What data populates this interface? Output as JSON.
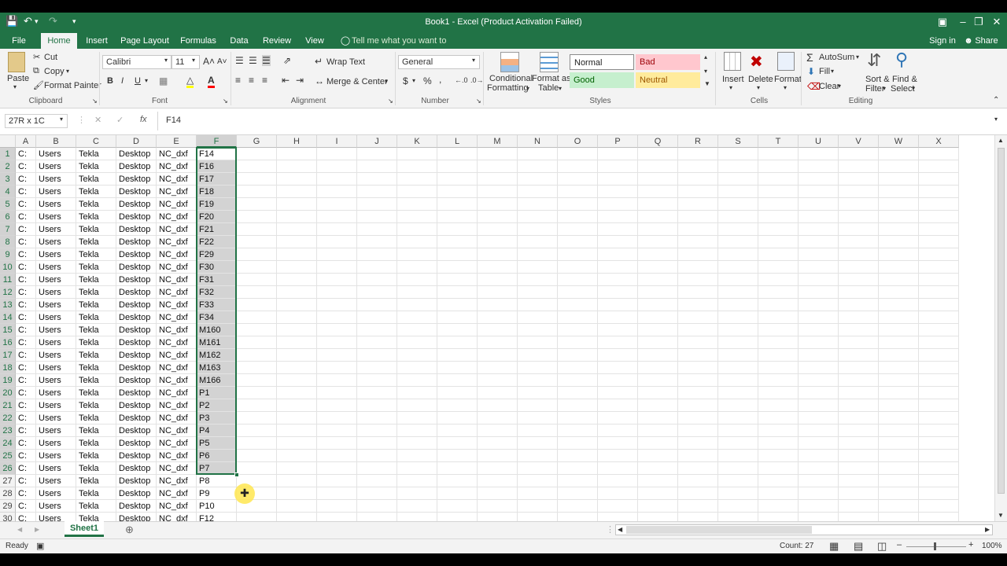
{
  "title": "Book1 - Excel (Product Activation Failed)",
  "tabs": [
    "File",
    "Home",
    "Insert",
    "Page Layout",
    "Formulas",
    "Data",
    "Review",
    "View"
  ],
  "tell_me": "Tell me what you want to do...",
  "sign_in": "Sign in",
  "share": "Share",
  "clipboard": {
    "paste": "Paste",
    "cut": "Cut",
    "copy": "Copy",
    "format_painter": "Format Painter",
    "label": "Clipboard"
  },
  "font": {
    "name": "Calibri",
    "size": "11",
    "bold": "B",
    "italic": "I",
    "underline": "U",
    "label": "Font"
  },
  "alignment": {
    "wrap_text": "Wrap Text",
    "merge_center": "Merge & Center",
    "label": "Alignment"
  },
  "number": {
    "format": "General",
    "currency": "$",
    "percent": "%",
    "comma": ",",
    "label": "Number"
  },
  "styles": {
    "conditional_formatting_1": "Conditional",
    "conditional_formatting_2": "Formatting",
    "format_as_table_1": "Format as",
    "format_as_table_2": "Table",
    "normal": "Normal",
    "bad": "Bad",
    "good": "Good",
    "neutral": "Neutral",
    "label": "Styles",
    "colors": {
      "normal": "#ffffff",
      "bad": "#ffc7ce",
      "good": "#c6efce",
      "neutral": "#ffeb9c"
    }
  },
  "cells_group": {
    "insert": "Insert",
    "delete": "Delete",
    "format": "Format",
    "label": "Cells"
  },
  "editing": {
    "autosum": "AutoSum",
    "fill": "Fill",
    "clear": "Clear",
    "sort_filter_1": "Sort &",
    "sort_filter_2": "Filter",
    "find_select_1": "Find &",
    "find_select_2": "Select",
    "label": "Editing"
  },
  "name_box": "27R x 1C",
  "fx": "fx",
  "formula": "F14",
  "columns": [
    "A",
    "B",
    "C",
    "D",
    "E",
    "F",
    "G",
    "H",
    "I",
    "J",
    "K",
    "L",
    "M",
    "N",
    "O",
    "P",
    "Q",
    "R",
    "S",
    "T",
    "U",
    "V",
    "W",
    "X"
  ],
  "rows": [
    [
      "1",
      "C:",
      "Users",
      "Tekla",
      "Desktop",
      "NC_dxf",
      "F14"
    ],
    [
      "2",
      "C:",
      "Users",
      "Tekla",
      "Desktop",
      "NC_dxf",
      "F16"
    ],
    [
      "3",
      "C:",
      "Users",
      "Tekla",
      "Desktop",
      "NC_dxf",
      "F17"
    ],
    [
      "4",
      "C:",
      "Users",
      "Tekla",
      "Desktop",
      "NC_dxf",
      "F18"
    ],
    [
      "5",
      "C:",
      "Users",
      "Tekla",
      "Desktop",
      "NC_dxf",
      "F19"
    ],
    [
      "6",
      "C:",
      "Users",
      "Tekla",
      "Desktop",
      "NC_dxf",
      "F20"
    ],
    [
      "7",
      "C:",
      "Users",
      "Tekla",
      "Desktop",
      "NC_dxf",
      "F21"
    ],
    [
      "8",
      "C:",
      "Users",
      "Tekla",
      "Desktop",
      "NC_dxf",
      "F22"
    ],
    [
      "9",
      "C:",
      "Users",
      "Tekla",
      "Desktop",
      "NC_dxf",
      "F29"
    ],
    [
      "10",
      "C:",
      "Users",
      "Tekla",
      "Desktop",
      "NC_dxf",
      "F30"
    ],
    [
      "11",
      "C:",
      "Users",
      "Tekla",
      "Desktop",
      "NC_dxf",
      "F31"
    ],
    [
      "12",
      "C:",
      "Users",
      "Tekla",
      "Desktop",
      "NC_dxf",
      "F32"
    ],
    [
      "13",
      "C:",
      "Users",
      "Tekla",
      "Desktop",
      "NC_dxf",
      "F33"
    ],
    [
      "14",
      "C:",
      "Users",
      "Tekla",
      "Desktop",
      "NC_dxf",
      "F34"
    ],
    [
      "15",
      "C:",
      "Users",
      "Tekla",
      "Desktop",
      "NC_dxf",
      "M160"
    ],
    [
      "16",
      "C:",
      "Users",
      "Tekla",
      "Desktop",
      "NC_dxf",
      "M161"
    ],
    [
      "17",
      "C:",
      "Users",
      "Tekla",
      "Desktop",
      "NC_dxf",
      "M162"
    ],
    [
      "18",
      "C:",
      "Users",
      "Tekla",
      "Desktop",
      "NC_dxf",
      "M163"
    ],
    [
      "19",
      "C:",
      "Users",
      "Tekla",
      "Desktop",
      "NC_dxf",
      "M166"
    ],
    [
      "20",
      "C:",
      "Users",
      "Tekla",
      "Desktop",
      "NC_dxf",
      "P1"
    ],
    [
      "21",
      "C:",
      "Users",
      "Tekla",
      "Desktop",
      "NC_dxf",
      "P2"
    ],
    [
      "22",
      "C:",
      "Users",
      "Tekla",
      "Desktop",
      "NC_dxf",
      "P3"
    ],
    [
      "23",
      "C:",
      "Users",
      "Tekla",
      "Desktop",
      "NC_dxf",
      "P4"
    ],
    [
      "24",
      "C:",
      "Users",
      "Tekla",
      "Desktop",
      "NC_dxf",
      "P5"
    ],
    [
      "25",
      "C:",
      "Users",
      "Tekla",
      "Desktop",
      "NC_dxf",
      "P6"
    ],
    [
      "26",
      "C:",
      "Users",
      "Tekla",
      "Desktop",
      "NC_dxf",
      "P7"
    ],
    [
      "27",
      "C:",
      "Users",
      "Tekla",
      "Desktop",
      "NC_dxf",
      "P8"
    ],
    [
      "28",
      "C:",
      "Users",
      "Tekla",
      "Desktop",
      "NC_dxf",
      "P9"
    ],
    [
      "29",
      "C:",
      "Users",
      "Tekla",
      "Desktop",
      "NC_dxf",
      "P10"
    ],
    [
      "30",
      "C:",
      "Users",
      "Tekla",
      "Desktop",
      "NC_dxf",
      "F12"
    ]
  ],
  "selected_rows": 26,
  "sheet_tab": "Sheet1",
  "status": {
    "ready": "Ready",
    "count": "Count: 27",
    "zoom": "100%"
  },
  "accent_color": "#217346"
}
